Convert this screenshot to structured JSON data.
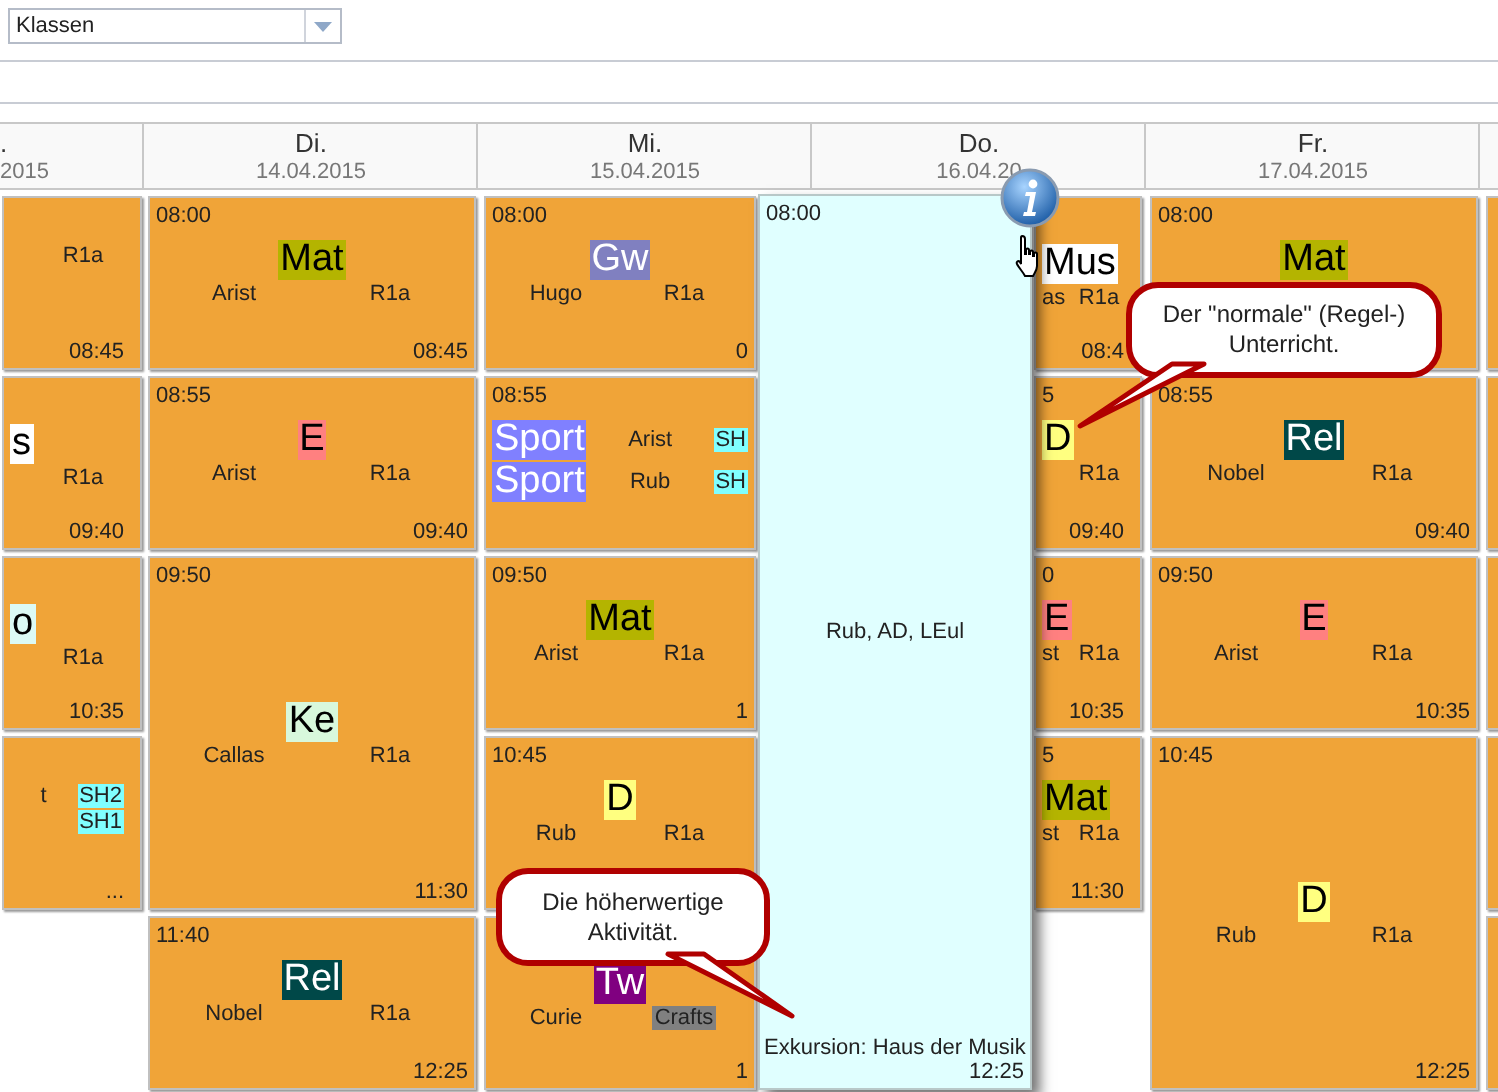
{
  "filter": {
    "value": "Klassen"
  },
  "header": [
    {
      "kind": "partial",
      "day": ".",
      "date": "2015"
    },
    {
      "kind": "day",
      "day": "Di.",
      "date": "14.04.2015"
    },
    {
      "kind": "day",
      "day": "Mi.",
      "date": "15.04.2015"
    },
    {
      "kind": "day",
      "day": "Do.",
      "date": "16.04.20"
    },
    {
      "kind": "day",
      "day": "Fr.",
      "date": "17.04.2015"
    },
    {
      "kind": "edge"
    }
  ],
  "body_columns": [
    {
      "kind": "strip",
      "cells": [
        {
          "kind": "single",
          "entries": [
            {
              "room": "R1a"
            }
          ],
          "end": "08:45"
        },
        {
          "kind": "single",
          "entries": [
            {
              "subject": "s",
              "color": "#ffffff",
              "room": "R1a"
            }
          ],
          "end": "09:40"
        },
        {
          "kind": "single",
          "entries": [
            {
              "subject": "o",
              "color": "#dcfaf5",
              "room": "R1a"
            }
          ],
          "end": "10:35"
        },
        {
          "kind": "single",
          "entries": [
            {
              "teacher": "t",
              "room": {
                "name": "SH2",
                "color": "#80ffff"
              }
            },
            {
              "room": {
                "name": "SH1",
                "color": "#80ffff"
              }
            }
          ],
          "more": "..."
        },
        {
          "kind": "empty"
        }
      ]
    },
    {
      "kind": "day",
      "cells": [
        {
          "kind": "single",
          "start": "08:00",
          "entries": [
            {
              "subject": "Mat",
              "color": "#b4b400",
              "teacher": "Arist",
              "room": "R1a"
            }
          ],
          "end": "08:45"
        },
        {
          "kind": "single",
          "start": "08:55",
          "entries": [
            {
              "subject": "E",
              "color": "#ff8080",
              "teacher": "Arist",
              "room": "R1a"
            }
          ],
          "end": "09:40"
        },
        {
          "kind": "double",
          "start": "09:50",
          "entries": [
            {
              "subject": "Ke",
              "color": "#d8f8dc",
              "teacher": "Callas",
              "room": "R1a"
            }
          ],
          "end": "11:30"
        },
        {
          "kind": "single",
          "start": "11:40",
          "entries": [
            {
              "subject": "Rel",
              "color": "#004848",
              "teacher": "Nobel",
              "room": "R1a"
            }
          ],
          "end": "12:25"
        }
      ]
    },
    {
      "kind": "narrow",
      "cells": [
        {
          "kind": "single",
          "start": "08:00",
          "entries": [
            {
              "subject": "Gw",
              "color": "#8080c0",
              "teacher": "Hugo",
              "room": "R1a"
            }
          ],
          "end": "0"
        },
        {
          "kind": "single",
          "start": "08:55",
          "entries": [
            {
              "subject": "Sport",
              "color": "#8080ff",
              "teacher": "Arist",
              "room": {
                "name": "SH",
                "color": "#80ffff"
              }
            },
            {
              "subject": "Sport",
              "color": "#8080ff",
              "teacher": "Rub",
              "room": {
                "name": "SH",
                "color": "#80ffff"
              }
            }
          ]
        },
        {
          "kind": "single",
          "start": "09:50",
          "entries": [
            {
              "subject": "Mat",
              "color": "#b4b400",
              "teacher": "Arist",
              "room": "R1a"
            }
          ],
          "end": "1"
        },
        {
          "kind": "single",
          "start": "10:45",
          "entries": [
            {
              "subject": "D",
              "color": "#ffff80",
              "teacher": "Rub",
              "room": "R1a"
            }
          ]
        },
        {
          "kind": "single",
          "entries": [
            {
              "subject": "Tw",
              "color": "#800080",
              "teacher": "Curie",
              "room": {
                "name": "Crafts",
                "color": "#808080"
              }
            }
          ],
          "end": "1"
        }
      ]
    },
    {
      "kind": "event",
      "start": "08:00",
      "participants": "Rub, AD, LEul",
      "title": "Exkursion: Haus der Musik",
      "end": "12:25"
    },
    {
      "kind": "strip",
      "cells": [
        {
          "kind": "single",
          "entries": [
            {
              "subject": "Mus",
              "color": "#ffffff",
              "teacher": "as",
              "room": "R1a"
            }
          ],
          "end": "08:4"
        },
        {
          "kind": "single",
          "start": "5",
          "entries": [
            {
              "subject": "D",
              "color": "#ffff80",
              "room": "R1a"
            }
          ],
          "end": "09:40"
        },
        {
          "kind": "single",
          "start": "0",
          "entries": [
            {
              "subject": "E",
              "color": "#ff8080",
              "teacher": "st",
              "room": "R1a"
            }
          ],
          "end": "10:35"
        },
        {
          "kind": "single",
          "start": "5",
          "entries": [
            {
              "subject": "Mat",
              "color": "#b4b400",
              "teacher": "st",
              "room": "R1a"
            }
          ],
          "end": "11:30"
        },
        {
          "kind": "empty"
        }
      ]
    },
    {
      "kind": "day",
      "cells": [
        {
          "kind": "single",
          "start": "08:00",
          "entries": [
            {
              "subject": "Mat",
              "color": "#b4b400"
            }
          ]
        },
        {
          "kind": "single",
          "start": "08:55",
          "entries": [
            {
              "subject": "Rel",
              "color": "#004848",
              "teacher": "Nobel",
              "room": "R1a"
            }
          ],
          "end": "09:40"
        },
        {
          "kind": "single",
          "start": "09:50",
          "entries": [
            {
              "subject": "E",
              "color": "#ff8080",
              "teacher": "Arist",
              "room": "R1a"
            }
          ],
          "end": "10:35"
        },
        {
          "kind": "double",
          "start": "10:45",
          "entries": [
            {
              "subject": "D",
              "color": "#ffff80",
              "teacher": "Rub",
              "room": "R1a"
            }
          ],
          "end": "12:25"
        }
      ]
    },
    {
      "kind": "edge",
      "cells": [
        {
          "kind": "single"
        },
        {
          "kind": "single"
        },
        {
          "kind": "single"
        },
        {
          "kind": "single"
        },
        {
          "kind": "single"
        }
      ]
    }
  ],
  "callouts": [
    {
      "kind": "right",
      "text": "Der \"normale\" (Regel-) Unterricht."
    },
    {
      "kind": "left",
      "text": "Die höherwertige Aktivität."
    }
  ]
}
